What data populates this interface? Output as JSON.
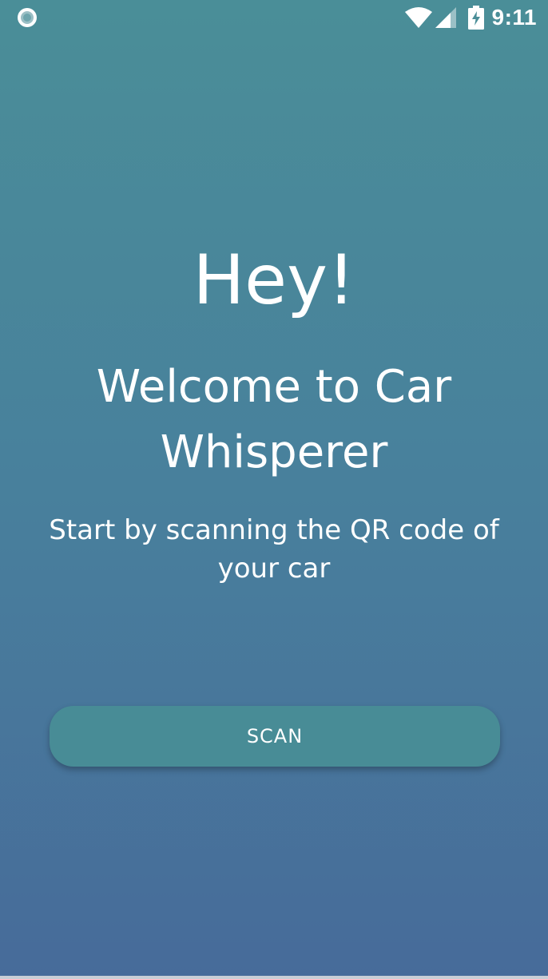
{
  "status_bar": {
    "time": "9:11",
    "icons": [
      "notification-circle-icon",
      "wifi-icon",
      "cell-signal-icon",
      "battery-charging-icon"
    ]
  },
  "welcome": {
    "greeting": "Hey!",
    "title": "Welcome to Car Whisperer",
    "subtitle": "Start by scanning the QR code of your car"
  },
  "actions": {
    "scan_label": "SCAN"
  },
  "colors": {
    "gradient_top": "#4a8e98",
    "gradient_bottom": "#476b9a",
    "button": "#488c96",
    "text": "#ffffff"
  }
}
